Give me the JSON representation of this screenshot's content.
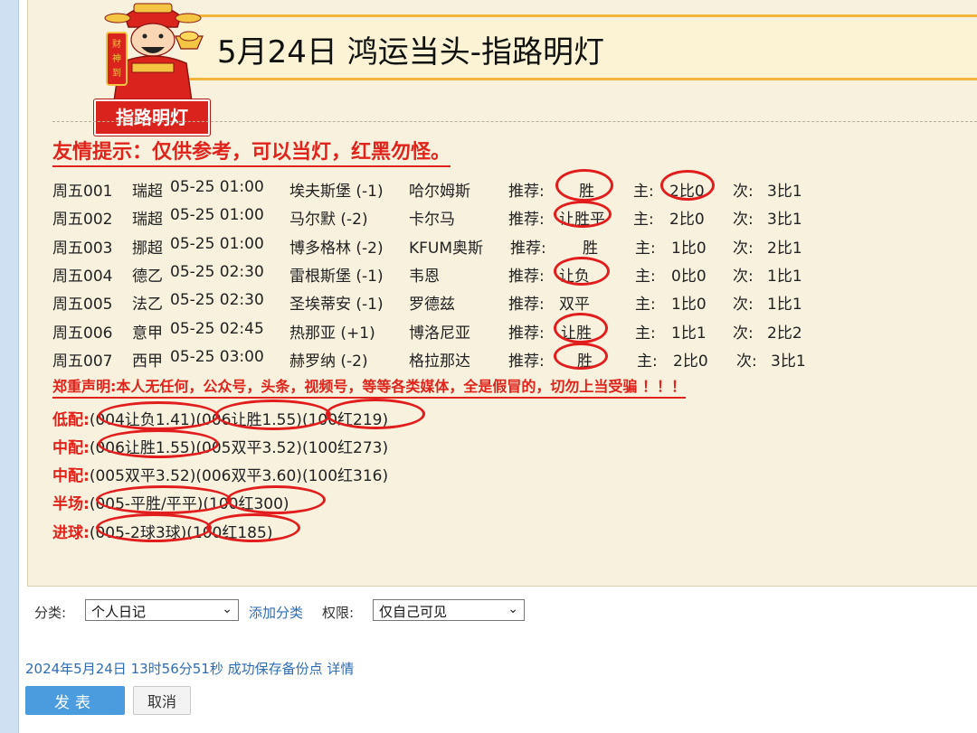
{
  "header": {
    "title": "5月24日  鸿运当头-指路明灯",
    "badge_text": "指路明灯",
    "mascot_text": "财神到"
  },
  "tip": "友情提示：仅供参考，可以当灯，红黑勿怪。",
  "matches": [
    {
      "id": "周五001",
      "league": "瑞超",
      "time": "05-25 01:00",
      "home": "埃夫斯堡 (-1)",
      "away": "哈尔姆斯",
      "rec_label": "推荐:",
      "rec": "胜",
      "main_label": "主:",
      "main": "2比0",
      "sub_label": "次:",
      "sub": "3比1"
    },
    {
      "id": "周五002",
      "league": "瑞超",
      "time": "05-25 01:00",
      "home": "马尔默 (-2)",
      "away": "卡尔马",
      "rec_label": "推荐:",
      "rec": "让胜平",
      "main_label": "主:",
      "main": "2比0",
      "sub_label": "次:",
      "sub": "3比1"
    },
    {
      "id": "周五003",
      "league": "挪超",
      "time": "05-25 01:00",
      "home": "博多格林 (-2)",
      "away": "KFUM奥斯",
      "rec_label": "推荐:",
      "rec": "胜",
      "main_label": "主:",
      "main": "1比0",
      "sub_label": "次:",
      "sub": "2比1"
    },
    {
      "id": "周五004",
      "league": "德乙",
      "time": "05-25 02:30",
      "home": "雷根斯堡 (-1)",
      "away": "韦恩",
      "rec_label": "推荐:",
      "rec": "让负",
      "main_label": "主:",
      "main": "0比0",
      "sub_label": "次:",
      "sub": "1比1"
    },
    {
      "id": "周五005",
      "league": "法乙",
      "time": "05-25 02:30",
      "home": "圣埃蒂安 (-1)",
      "away": "罗德兹",
      "rec_label": "推荐:",
      "rec": "双平",
      "main_label": "主:",
      "main": "1比0",
      "sub_label": "次:",
      "sub": "1比1"
    },
    {
      "id": "周五006",
      "league": "意甲",
      "time": "05-25 02:45",
      "home": "热那亚 (+1)",
      "away": "博洛尼亚",
      "rec_label": "推荐:",
      "rec": "让胜",
      "main_label": "主:",
      "main": "1比1",
      "sub_label": "次:",
      "sub": "2比2"
    },
    {
      "id": "周五007",
      "league": "西甲",
      "time": "05-25 03:00",
      "home": "赫罗纳 (-2)",
      "away": "格拉那达",
      "rec_label": "推荐:",
      "rec": "胜",
      "main_label": "主:",
      "main": "2比0",
      "sub_label": "次:",
      "sub": "3比1"
    }
  ],
  "notice": "郑重声明:本人无任何，公众号，头条，视频号，等等各类媒体，全是假冒的，切勿上当受骗 ！！！",
  "combos": [
    {
      "label": "低配:",
      "text": "(004让负1.41)(006让胜1.55)(100红219)"
    },
    {
      "label": "中配:",
      "text": "(006让胜1.55)(005双平3.52)(100红273)"
    },
    {
      "label": "中配:",
      "text": "(005双平3.52)(006双平3.60)(100红316)"
    },
    {
      "label": "半场:",
      "text": "(005-平胜/平平)(100红300)"
    },
    {
      "label": "进球:",
      "text": "(005-2球3球)(100红185)"
    }
  ],
  "toolbar": {
    "category_label": "分类:",
    "category_value": "个人日记",
    "add_category": "添加分类",
    "permission_label": "权限:",
    "permission_value": "仅自己可见"
  },
  "status": {
    "text": "2024年5月24日 13时56分51秒 成功保存备份点",
    "detail_link": "详情"
  },
  "buttons": {
    "publish": "发表",
    "cancel": "取消"
  },
  "colors": {
    "accent_red": "#e0231b",
    "link_blue": "#2d6cb3",
    "panel_bg": "#f7f1dd",
    "publish_blue": "#4b9bdf"
  }
}
